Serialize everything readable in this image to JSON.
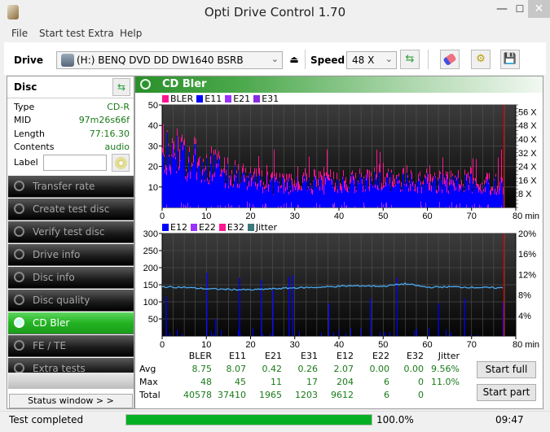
{
  "window": {
    "title": "Opti Drive Control 1.70",
    "minimize": "—",
    "maximize": "☐",
    "close": "✕"
  },
  "menu": [
    "File",
    "Start test",
    "Extra",
    "Help"
  ],
  "toolbar": {
    "drive_label": "Drive",
    "drive_value": "(H:)  BENQ DVD DD DW1640 BSRB",
    "speed_label": "Speed",
    "speed_value": "48 X",
    "eject_icon": "⏏",
    "refresh_icon": "⇆",
    "erase_icon": "eraser",
    "config_icon": "gear",
    "save_icon": "floppy"
  },
  "disc": {
    "title": "Disc",
    "rows": [
      {
        "key": "Type",
        "value": "CD-R"
      },
      {
        "key": "MID",
        "value": "97m26s66f"
      },
      {
        "key": "Length",
        "value": "77:16.30"
      },
      {
        "key": "Contents",
        "value": "audio"
      }
    ],
    "label_key": "Label",
    "label_value": ""
  },
  "nav": [
    {
      "label": "Transfer rate",
      "active": false
    },
    {
      "label": "Create test disc",
      "active": false
    },
    {
      "label": "Verify test disc",
      "active": false
    },
    {
      "label": "Drive info",
      "active": false
    },
    {
      "label": "Disc info",
      "active": false
    },
    {
      "label": "Disc quality",
      "active": false
    },
    {
      "label": "CD Bler",
      "active": true
    },
    {
      "label": "FE / TE",
      "active": false
    },
    {
      "label": "Extra tests",
      "active": false
    }
  ],
  "status_window_label": "Status window > >",
  "panel": {
    "title": "CD Bler"
  },
  "chart_data": [
    {
      "type": "bar",
      "title": "BLER / E11 / E21 / E31",
      "legend": [
        {
          "name": "BLER",
          "color": "#ff1493"
        },
        {
          "name": "E11",
          "color": "#0000ff"
        },
        {
          "name": "E21",
          "color": "#9b30ff"
        },
        {
          "name": "E31",
          "color": "#8a2be2"
        }
      ],
      "xlabel": "min",
      "xlim": [
        0,
        80
      ],
      "x_ticks": [
        "0",
        "10",
        "20",
        "30",
        "40",
        "50",
        "60",
        "70",
        "80 min"
      ],
      "ylim": [
        0,
        50
      ],
      "y_ticks": [
        "10",
        "20",
        "30",
        "40",
        "50"
      ],
      "y2_ticks": [
        "8 X",
        "16 X",
        "24 X",
        "32 X",
        "40 X",
        "48 X",
        "56 X"
      ],
      "end_marker_min": 77.3,
      "series": [
        {
          "name": "BLER",
          "approx_profile_by_5min": [
            38,
            32,
            28,
            22,
            18,
            16,
            16,
            15,
            15,
            16,
            17,
            16,
            17,
            16,
            16,
            15
          ]
        },
        {
          "name": "E11",
          "approx_profile_by_5min": [
            30,
            26,
            22,
            18,
            14,
            12,
            12,
            12,
            12,
            13,
            14,
            13,
            13,
            13,
            13,
            12
          ]
        }
      ],
      "grid": true
    },
    {
      "type": "bar",
      "title": "E12 / E22 / E32 / Jitter",
      "legend": [
        {
          "name": "E12",
          "color": "#0000ff"
        },
        {
          "name": "E22",
          "color": "#9b30ff"
        },
        {
          "name": "E32",
          "color": "#ff1493"
        },
        {
          "name": "Jitter",
          "color": "#3a7a7a"
        }
      ],
      "xlabel": "min",
      "xlim": [
        0,
        80
      ],
      "x_ticks": [
        "0",
        "10",
        "20",
        "30",
        "40",
        "50",
        "60",
        "70",
        "80 min"
      ],
      "ylim": [
        0,
        300
      ],
      "y_ticks": [
        "50",
        "100",
        "150",
        "200",
        "250",
        "300"
      ],
      "y2_ticks": [
        "4%",
        "8%",
        "12%",
        "16%",
        "20%"
      ],
      "y2lim": [
        0,
        20
      ],
      "end_marker_min": 77.3,
      "jitter_line_pct_by_5min": [
        9.6,
        9.5,
        9.2,
        9.1,
        9.0,
        9.2,
        9.4,
        9.5,
        9.7,
        9.8,
        9.7,
        10.2,
        9.5,
        9.6,
        9.5,
        9.4
      ],
      "e12_spikes": [
        {
          "min": 0.8,
          "value": 115
        },
        {
          "min": 10,
          "value": 185
        },
        {
          "min": 12,
          "value": 50
        },
        {
          "min": 17.4,
          "value": 170
        },
        {
          "min": 22.3,
          "value": 165
        },
        {
          "min": 25,
          "value": 135
        },
        {
          "min": 28.6,
          "value": 173
        },
        {
          "min": 29.4,
          "value": 178
        },
        {
          "min": 37.6,
          "value": 95
        },
        {
          "min": 47,
          "value": 110
        },
        {
          "min": 53,
          "value": 170
        },
        {
          "min": 62.4,
          "value": 95
        },
        {
          "min": 68.3,
          "value": 110
        },
        {
          "min": 77,
          "value": 100
        }
      ],
      "grid": true
    }
  ],
  "stats": {
    "columns": [
      "BLER",
      "E11",
      "E21",
      "E31",
      "E12",
      "E22",
      "E32",
      "Jitter"
    ],
    "rows": [
      {
        "label": "Avg",
        "values": [
          "8.75",
          "8.07",
          "0.42",
          "0.26",
          "2.07",
          "0.00",
          "0.00",
          "9.56%"
        ]
      },
      {
        "label": "Max",
        "values": [
          "48",
          "45",
          "11",
          "17",
          "204",
          "6",
          "0",
          "11.0%"
        ]
      },
      {
        "label": "Total",
        "values": [
          "40578",
          "37410",
          "1965",
          "1203",
          "9612",
          "6",
          "0",
          ""
        ]
      }
    ]
  },
  "buttons": {
    "start_full": "Start full",
    "start_part": "Start part"
  },
  "statusbar": {
    "text": "Test completed",
    "progress": 100.0,
    "progress_label": "100.0%",
    "time": "09:47"
  }
}
